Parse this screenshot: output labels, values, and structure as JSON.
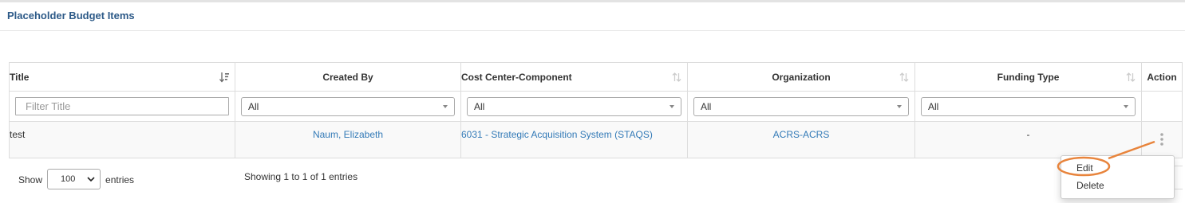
{
  "panel": {
    "title": "Placeholder Budget Items"
  },
  "table": {
    "columns": [
      {
        "label": "Title"
      },
      {
        "label": "Created By"
      },
      {
        "label": "Cost Center-Component"
      },
      {
        "label": "Organization"
      },
      {
        "label": "Funding Type"
      },
      {
        "label": "Action"
      }
    ],
    "filters": {
      "title_placeholder": "Filter Title",
      "created_by": "All",
      "cost_center": "All",
      "organization": "All",
      "funding_type": "All"
    },
    "rows": [
      {
        "title": "test",
        "created_by": "Naum, Elizabeth",
        "cost_center": "6031 - Strategic Acquisition System (STAQS)",
        "organization": "ACRS-ACRS",
        "funding_type": "-"
      }
    ]
  },
  "footer": {
    "show_label": "Show",
    "page_length": "100",
    "entries_label": "entries",
    "info": "Showing 1 to 1 of 1 entries"
  },
  "action_menu": {
    "items": [
      "Edit",
      "Delete"
    ]
  },
  "colors": {
    "title": "#2d5a88",
    "link": "#337ab7",
    "highlight": "#e8843c"
  },
  "icons": {
    "sort_active": "sort-amount-icon",
    "sort": "sort-arrows-icon",
    "row_menu": "vertical-dots-icon"
  }
}
